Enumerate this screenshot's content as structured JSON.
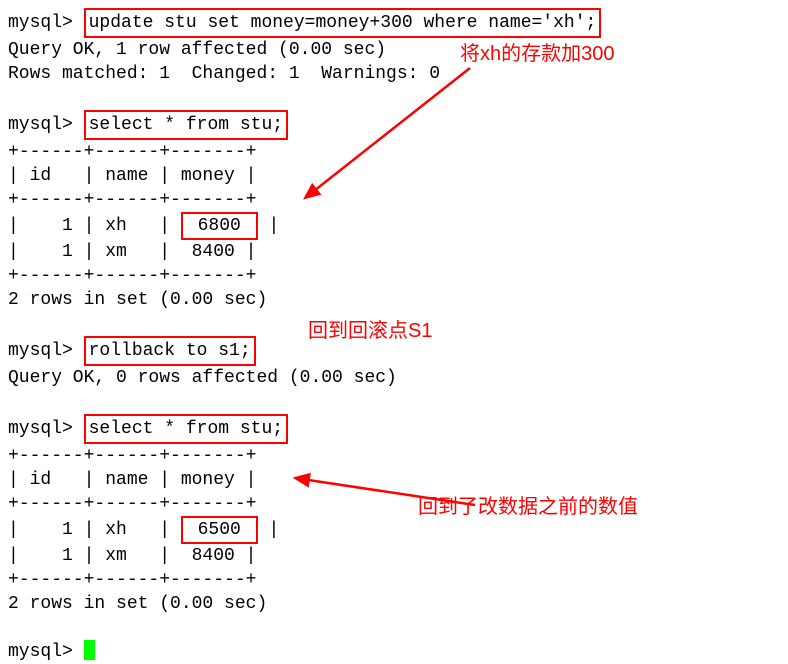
{
  "prompt": "mysql>",
  "cmd1": "update stu set money=money+300 where name='xh';",
  "res1a": "Query OK, 1 row affected (0.00 sec)",
  "res1b": "Rows matched: 1  Changed: 1  Warnings: 0",
  "annot1": "将xh的存款加300",
  "cmd2": "select * from stu;",
  "table1": {
    "border": "+------+------+-------+",
    "header": "| id   | name | money |",
    "row_xh_pre": "|    1 | xh   | ",
    "row_xh_val": " 6800 ",
    "row_xh_post": "|",
    "row_xm": "|    1 | xm   |  8400 |",
    "footer": "2 rows in set (0.00 sec)"
  },
  "cmd3": "rollback to s1;",
  "annot2": "回到回滚点S1",
  "res3": "Query OK, 0 rows affected (0.00 sec)",
  "cmd4": "select * from stu;",
  "table2": {
    "border": "+------+------+-------+",
    "header": "| id   | name | money |",
    "row_xh_pre": "|    1 | xh   | ",
    "row_xh_val": " 6500 ",
    "row_xh_post": "|",
    "row_xm": "|    1 | xm   |  8400 |",
    "footer": "2 rows in set (0.00 sec)"
  },
  "annot3": "回到了改数据之前的数值"
}
